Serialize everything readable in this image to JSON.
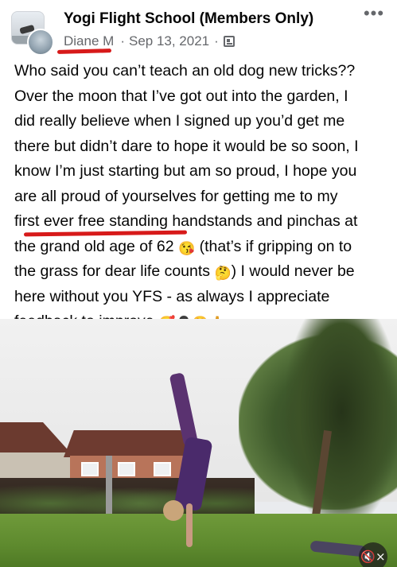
{
  "post": {
    "group_name": "Yogi Flight School (Members Only)",
    "author": "Diane M",
    "separator": "·",
    "date": "Sep 13, 2021",
    "privacy_icon": "group-privacy-icon",
    "more_label": "•••",
    "text_lines": [
      "Who said you can’t teach an old dog new tricks??",
      "Over the moon that I’ve got out into the garden, I",
      "did really believe when I signed up you’d get me",
      "there but didn’t dare to hope it would be so soon, I",
      "know I’m just starting but am so proud, I hope you",
      "are all proud of yourselves for getting me to my",
      "first ever free standing handstands and pinchas at"
    ],
    "line8": {
      "before": "the ",
      "highlight": "grand old age of 62",
      "emoji": "😘",
      "after": " (that’s if gripping on to"
    },
    "line9": {
      "text": "the grass for dear life counts ",
      "emoji": "🤔",
      "after": ") I would never be"
    },
    "line10": "here without you YFS - as always I appreciate",
    "line11": {
      "text": "feedback to improve ",
      "emojis": "🥰🥷😍🙏"
    },
    "annotation_color": "#d71a1a"
  },
  "video": {
    "mute_label": "🔇×",
    "mute_icon": "speaker-muted-icon"
  }
}
